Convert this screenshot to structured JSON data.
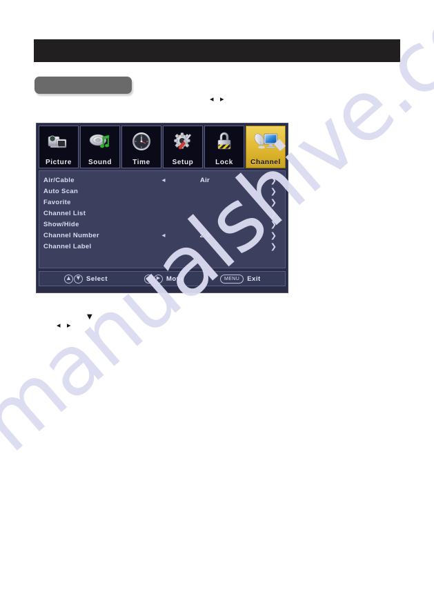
{
  "page": {
    "background_color": "#ffffff",
    "watermark_text": "manualshive.com",
    "watermark_color": "#dcdcf2"
  },
  "redacted_banner": {
    "label": "",
    "color": "#211f20"
  },
  "grey_chip": {
    "label": "",
    "color": "#6b6a6b"
  },
  "inline_glyphs": {
    "top_pair": "◂ ▸",
    "down": "▼",
    "bottom_pair": "◂ ▸"
  },
  "osd": {
    "panel_color": "#3c3f5e",
    "frame_color": "#2a2c48",
    "accent_color": "#e0b730",
    "tabs": [
      {
        "label": "Picture",
        "icon": "camcorder-icon",
        "active": false
      },
      {
        "label": "Sound",
        "icon": "speaker-music-note-icon",
        "active": false
      },
      {
        "label": "Time",
        "icon": "clock-dial-icon",
        "active": false
      },
      {
        "label": "Setup",
        "icon": "gear-screwdriver-icon",
        "active": false
      },
      {
        "label": "Lock",
        "icon": "padlock-icon",
        "active": false
      },
      {
        "label": "Channel",
        "icon": "satellite-dish-monitor-icon",
        "active": true
      }
    ],
    "rows": [
      {
        "label": "Air/Cable",
        "left_arrow": "◂",
        "value": "Air",
        "right_arrow": "❯"
      },
      {
        "label": "Auto Scan",
        "left_arrow": "",
        "value": "",
        "right_arrow": "❯"
      },
      {
        "label": "Favorite",
        "left_arrow": "",
        "value": "",
        "right_arrow": "❯"
      },
      {
        "label": "Channel List",
        "left_arrow": "",
        "value": "",
        "right_arrow": "❯"
      },
      {
        "label": "Show/Hide",
        "left_arrow": "",
        "value": "",
        "right_arrow": "❯"
      },
      {
        "label": "Channel Number",
        "left_arrow": "◂",
        "value": "2-0",
        "right_arrow": "❯"
      },
      {
        "label": "Channel Label",
        "left_arrow": "",
        "value": "",
        "right_arrow": "❯"
      }
    ],
    "footer": {
      "select": {
        "key_up": "▲",
        "key_down": "▼",
        "label": "Select"
      },
      "move": {
        "key_left": "◀",
        "key_right": "▶",
        "label": "Move"
      },
      "exit": {
        "key": "MENU",
        "label": "Exit"
      }
    }
  }
}
